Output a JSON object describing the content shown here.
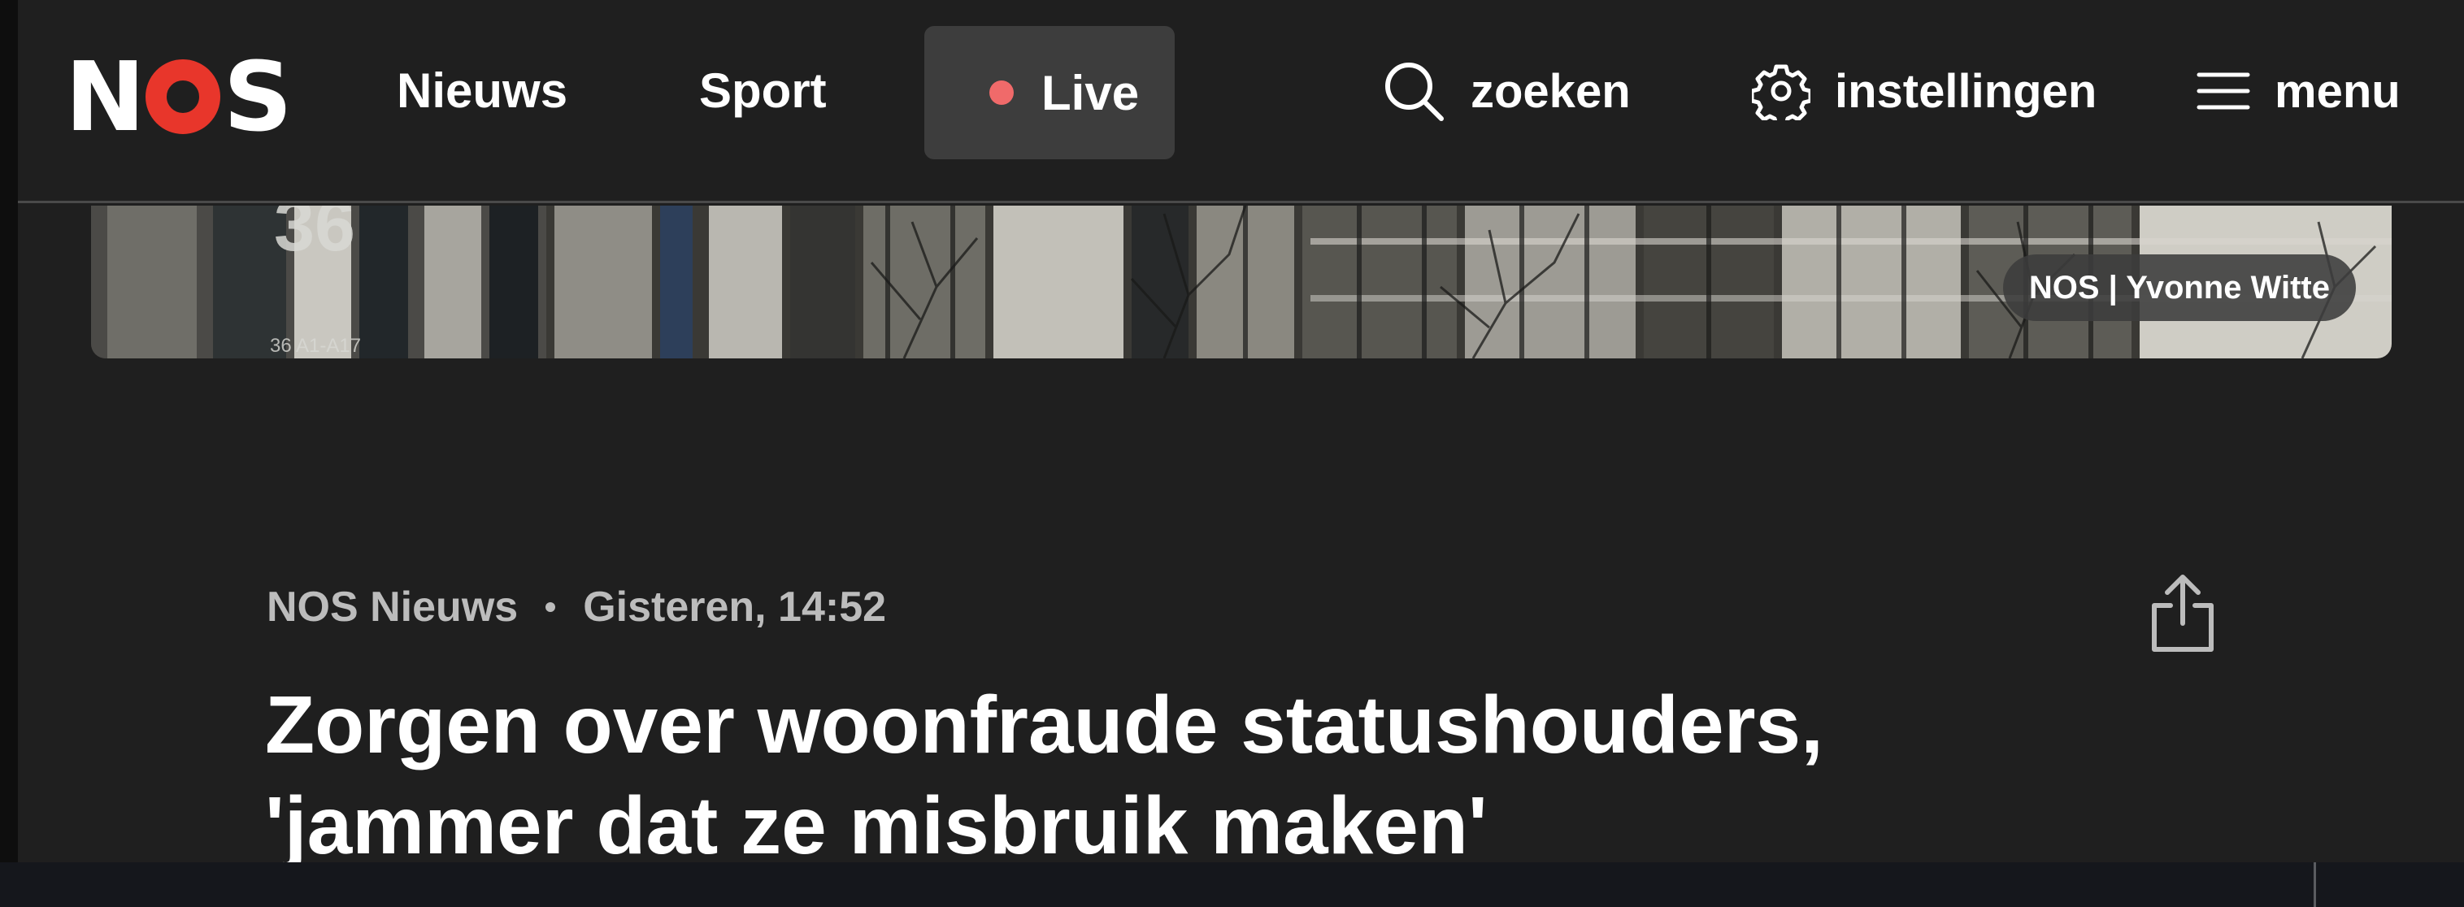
{
  "header": {
    "logo": {
      "text_left": "N",
      "text_right": "S",
      "accent_color": "#e8362b"
    },
    "nav": {
      "news_label": "Nieuws",
      "sport_label": "Sport",
      "live_label": "Live",
      "live_dot_color": "#f06a6a"
    },
    "search_label": "zoeken",
    "settings_label": "instellingen",
    "menu_label": "menu"
  },
  "hero": {
    "credit": "NOS | Yvonne Witte"
  },
  "article": {
    "source": "NOS Nieuws",
    "timestamp": "Gisteren, 14:52",
    "headline_line1": "Zorgen over woonfraude statushouders,",
    "headline_line2": "'jammer dat ze misbruik maken'"
  },
  "icons": {
    "search": "search-icon",
    "settings": "gear-icon",
    "menu": "hamburger-icon",
    "share": "share-icon"
  },
  "colors": {
    "background": "#1f1f1f",
    "text": "#ffffff",
    "meta_text": "#bcbcbc",
    "live_button_bg": "#3d3d3d"
  }
}
